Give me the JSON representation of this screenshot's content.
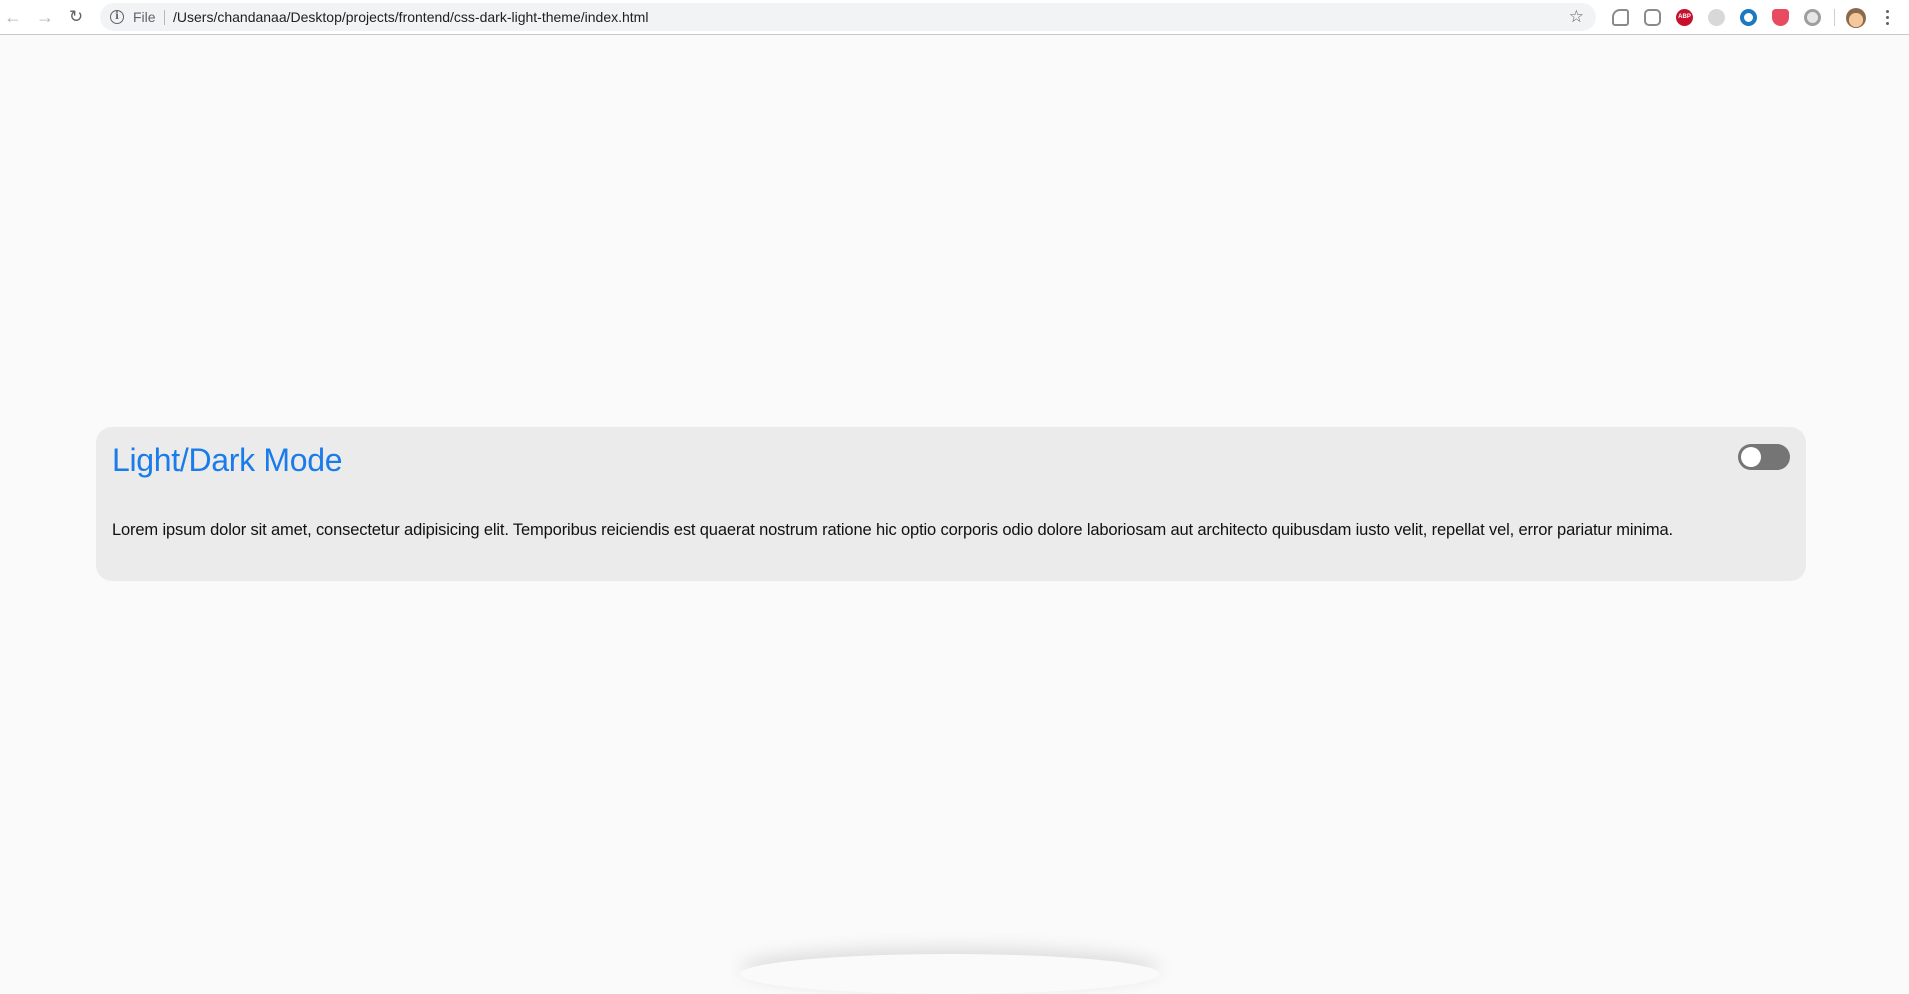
{
  "browser": {
    "back_icon": "arrow-left-icon",
    "forward_icon": "arrow-right-icon",
    "reload_icon": "reload-icon",
    "omnibox": {
      "scheme_label": "File",
      "url": "/Users/chandanaa/Desktop/projects/frontend/css-dark-light-theme/index.html",
      "info_icon": "info-icon",
      "bookmark_icon": "star-icon"
    },
    "extensions": [
      {
        "icon": "cast-icon",
        "color": "#8a8a8a"
      },
      {
        "icon": "robot-extension-icon",
        "color": "#8a8a8a"
      },
      {
        "icon": "adblock-icon",
        "color": "#c8102e"
      },
      {
        "icon": "grey-extension-icon",
        "color": "#bdbdbd"
      },
      {
        "icon": "blue-ring-extension-icon",
        "color": "#1a7bc0"
      },
      {
        "icon": "shield-extension-icon",
        "color": "#e84a5f"
      },
      {
        "icon": "circle-extension-icon",
        "color": "#9e9e9e"
      }
    ],
    "avatar_icon": "profile-avatar-icon",
    "menu_icon": "more-vert-icon"
  },
  "card": {
    "title": "Light/Dark Mode",
    "toggle_on": false,
    "text": "Lorem ipsum dolor sit amet, consectetur adipisicing elit. Temporibus reiciendis est quaerat nostrum ratione hic optio corporis odio dolore laboriosam aut architecto quibusdam iusto velit, repellat vel, error pariatur minima."
  },
  "colors": {
    "page_background": "#fafafa",
    "card_background": "#ebebeb",
    "title_color": "#1a7bea",
    "toggle_track": "#757575"
  }
}
